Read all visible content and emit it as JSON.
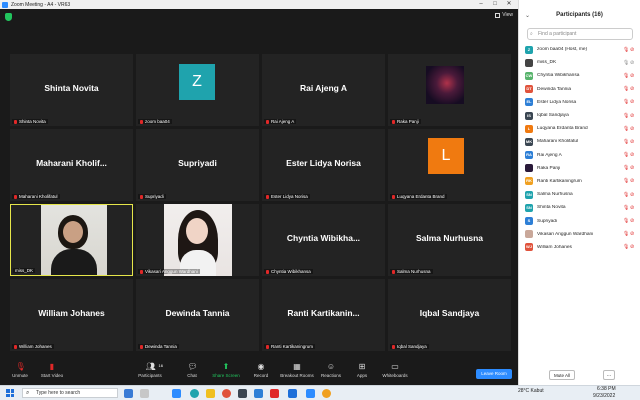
{
  "window": {
    "title": "Zoom Meeting - A4 - VR63",
    "view_label": "View"
  },
  "tiles": [
    {
      "name": "Shinta Novita",
      "caption": "Shinta Novita",
      "kind": "name"
    },
    {
      "name": "",
      "caption": "zoom baa04",
      "kind": "avatar",
      "letter": "Z",
      "color": "#1fa3ad"
    },
    {
      "name": "Rai Ajeng A",
      "caption": "Rai Ajeng A",
      "kind": "name"
    },
    {
      "name": "",
      "caption": "Raka Panji",
      "kind": "photo-dark"
    },
    {
      "name": "Maharani Kholif...",
      "caption": "Maharani Kholifatul",
      "kind": "name"
    },
    {
      "name": "Supriyadi",
      "caption": "Supriyadi",
      "kind": "name"
    },
    {
      "name": "Ester Lidya Norisa",
      "caption": "Ester Lidya Norisa",
      "kind": "name"
    },
    {
      "name": "",
      "caption": "Luqyana Erdanta Brand",
      "kind": "avatar",
      "letter": "L",
      "color": "#f07a10"
    },
    {
      "name": "",
      "caption": "miss_DK",
      "kind": "video-woman"
    },
    {
      "name": "",
      "caption": "Vikasari Anggun Wardhani",
      "kind": "video-woman2"
    },
    {
      "name": "Chyntia  Wibikha...",
      "caption": "Chyntia Wibikhansa",
      "kind": "name"
    },
    {
      "name": "Salma Nurhusna",
      "caption": "Salma Nurhusna",
      "kind": "name"
    },
    {
      "name": "William Johanes",
      "caption": "William Johanes",
      "kind": "name"
    },
    {
      "name": "Dewinda Tannia",
      "caption": "Dewinda Tannia",
      "kind": "name"
    },
    {
      "name": "Ranti  Kartikanin...",
      "caption": "Ranti Kartikaningrum",
      "kind": "name"
    },
    {
      "name": "Iqbal Sandjaya",
      "caption": "Iqbal Sandjaya",
      "kind": "name"
    }
  ],
  "toolbar": {
    "unmute": "Unmute",
    "start_video": "Start Video",
    "participants": "Participants",
    "participants_count": "16",
    "chat": "Chat",
    "share": "Share Screen",
    "record": "Record",
    "breakout": "Breakout Rooms",
    "reactions": "Reactions",
    "apps": "Apps",
    "whiteboards": "Whiteboards",
    "leave": "Leave Room"
  },
  "panel": {
    "title": "Participants (16)",
    "search_placeholder": "Find a participant",
    "participants": [
      {
        "initials": "Z",
        "color": "#1fa3ad",
        "name": "zoom baa04 (Host, me)"
      },
      {
        "initials": "",
        "color": "#444444",
        "name": "miss_DK",
        "photo": true
      },
      {
        "initials": "CW",
        "color": "#57b36b",
        "name": "Chyntia Wibikhansa"
      },
      {
        "initials": "DT",
        "color": "#e0533c",
        "name": "Dewinda Tannia"
      },
      {
        "initials": "EL",
        "color": "#2d7fd6",
        "name": "Ester Lidya Norisa"
      },
      {
        "initials": "IS",
        "color": "#3a4652",
        "name": "Iqbal Sandjaya"
      },
      {
        "initials": "L",
        "color": "#f07a10",
        "name": "Luqyana Erdanta Brand"
      },
      {
        "initials": "MK",
        "color": "#3a4652",
        "name": "Maharani Kholifatul"
      },
      {
        "initials": "RA",
        "color": "#2d7fd6",
        "name": "Rai Ajeng A"
      },
      {
        "initials": "",
        "color": "#2a1a3a",
        "name": "Raka Panji",
        "photo": true
      },
      {
        "initials": "RK",
        "color": "#f0a020",
        "name": "Ranti Kartikaningrum"
      },
      {
        "initials": "SN",
        "color": "#1fa3ad",
        "name": "Salma Nurhusna"
      },
      {
        "initials": "SN",
        "color": "#1fa3ad",
        "name": "Shinta Novita"
      },
      {
        "initials": "S",
        "color": "#2d7fd6",
        "name": "Supriyadi"
      },
      {
        "initials": "",
        "color": "#c9a89a",
        "name": "Vikasari Anggun Wardhani",
        "photo": true
      },
      {
        "initials": "WJ",
        "color": "#e0533c",
        "name": "William Johanes"
      }
    ],
    "mute_all": "Mute All",
    "more": "..."
  },
  "taskbar": {
    "search_placeholder": "Type here to search",
    "weather": "28°C  Kabut",
    "time": "6:38 PM",
    "date": "9/23/2022"
  }
}
